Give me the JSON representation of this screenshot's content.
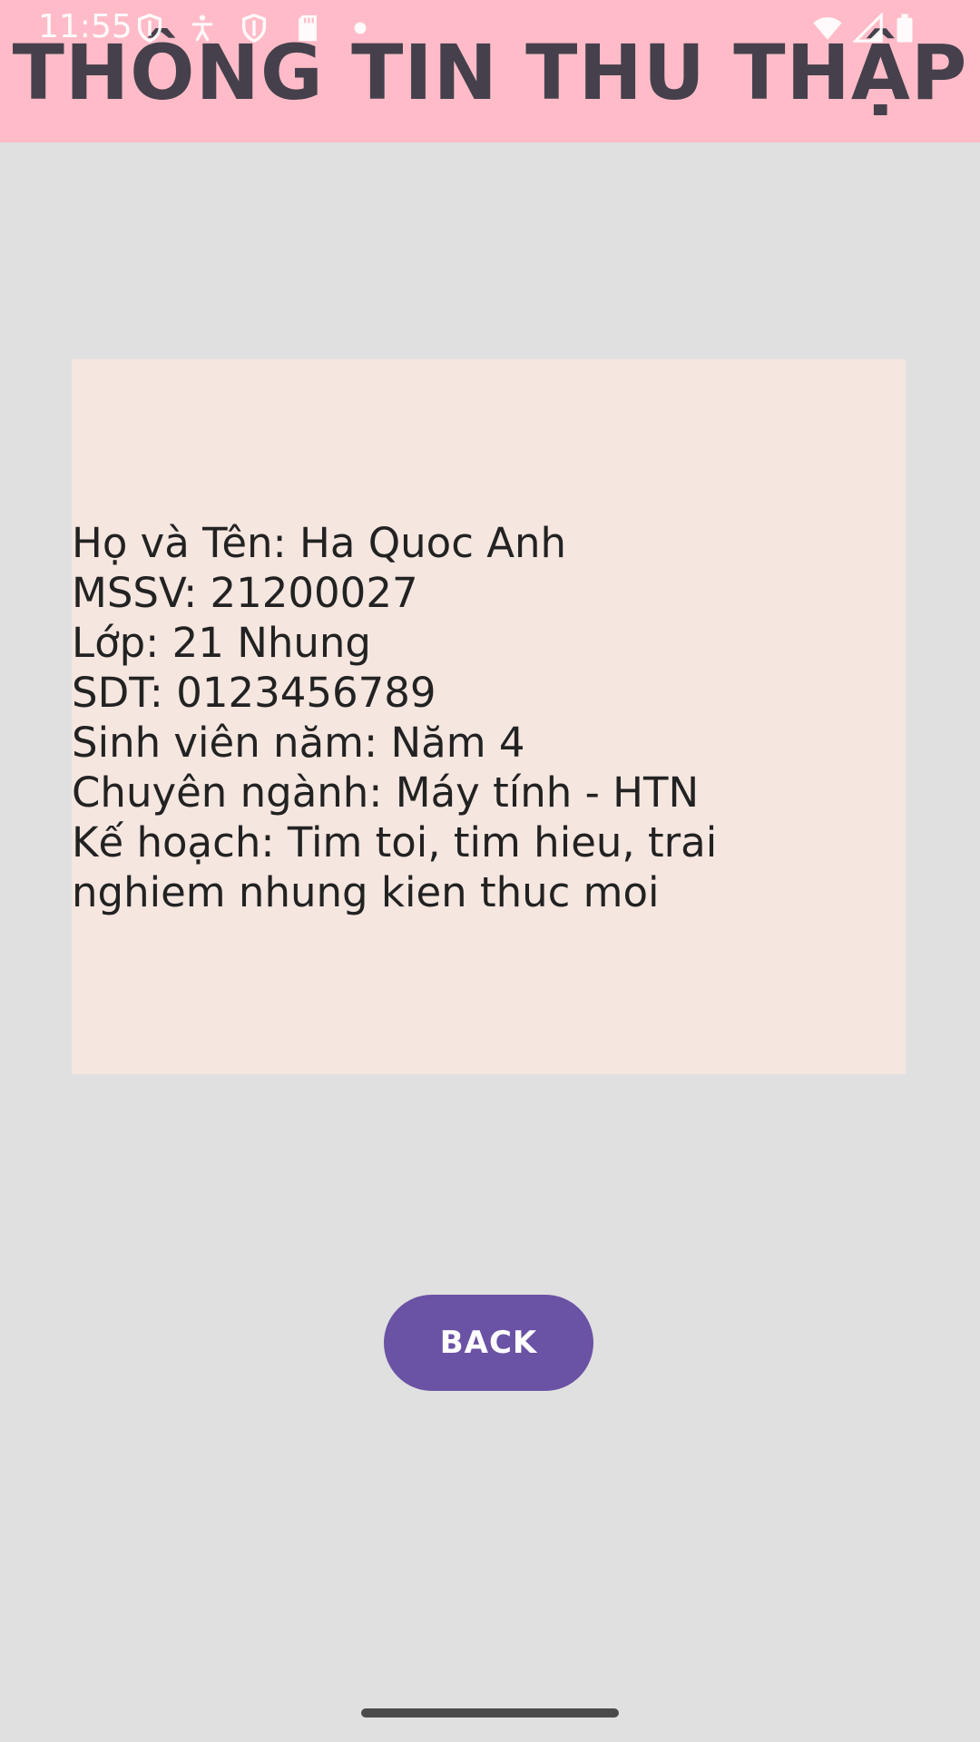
{
  "status_bar": {
    "time": "11:55",
    "icons": [
      "shield-icon",
      "accessibility-icon",
      "shield-icon",
      "sd-card-icon",
      "dot-icon",
      "wifi-icon",
      "signal-icon",
      "battery-icon"
    ]
  },
  "header": {
    "title": "THÔNG TIN THU THẬP",
    "background_color": "#ffbcc8"
  },
  "info_card": {
    "background_color": "#f5e6e0",
    "lines": [
      "Họ và Tên: Ha Quoc Anh",
      "MSSV: 21200027",
      "Lớp: 21 Nhung",
      "SDT: 0123456789",
      "Sinh viên năm: Năm 4",
      "Chuyên ngành: Máy tính - HTN",
      "Kế hoạch: Tim toi, tim hieu, trai nghiem nhung kien thuc moi"
    ]
  },
  "actions": {
    "back_label": "BACK",
    "accent_color": "#6a52a4"
  }
}
